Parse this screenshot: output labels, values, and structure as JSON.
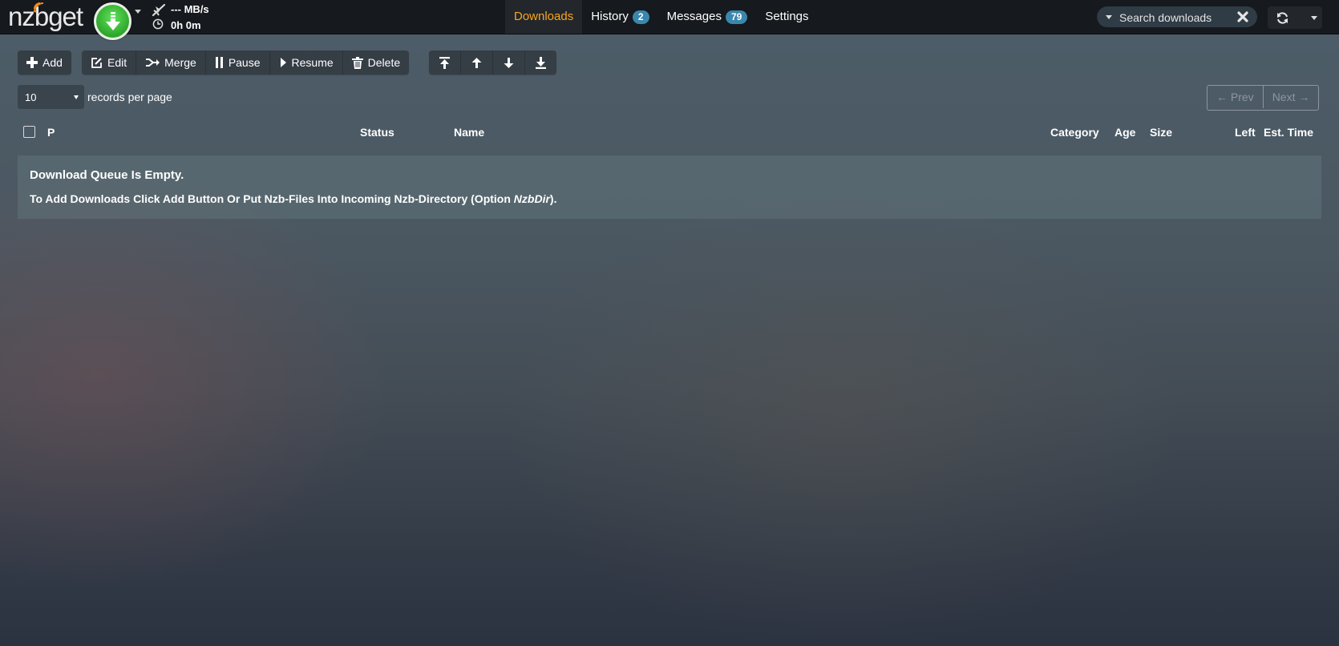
{
  "header": {
    "logo_text": "nzbget",
    "speed": "--- MB/s",
    "time": "0h 0m",
    "nav": [
      {
        "label": "Downloads",
        "active": true
      },
      {
        "label": "History",
        "badge": "2"
      },
      {
        "label": "Messages",
        "badge": "79"
      },
      {
        "label": "Settings"
      }
    ],
    "search_placeholder": "Search downloads",
    "icons": {
      "play": "download-arrow-icon",
      "speed": "airplane-icon",
      "time": "clock-icon",
      "clear": "close-icon",
      "refresh": "refresh-icon"
    }
  },
  "toolbar": {
    "add": "Add",
    "edit": "Edit",
    "merge": "Merge",
    "pause": "Pause",
    "resume": "Resume",
    "delete": "Delete"
  },
  "paging": {
    "records_per_page_value": "10",
    "records_per_page_label": "records per page",
    "prev": "← Prev",
    "next": "Next →"
  },
  "table": {
    "columns": {
      "priority": "P",
      "status": "Status",
      "name": "Name",
      "category": "Category",
      "age": "Age",
      "size": "Size",
      "left": "Left",
      "est_time": "Est. Time"
    },
    "empty_title": "Download Queue Is Empty.",
    "empty_text_before": "To Add Downloads Click Add Button Or Put Nzb-Files Into Incoming Nzb-Directory (Option ",
    "empty_text_option": "NzbDir",
    "empty_text_after": ")."
  },
  "colors": {
    "topbar_bg": "#16191d",
    "active_nav": "#f8a51d",
    "badge": "#3a87ad",
    "play_green": "#34b030"
  }
}
